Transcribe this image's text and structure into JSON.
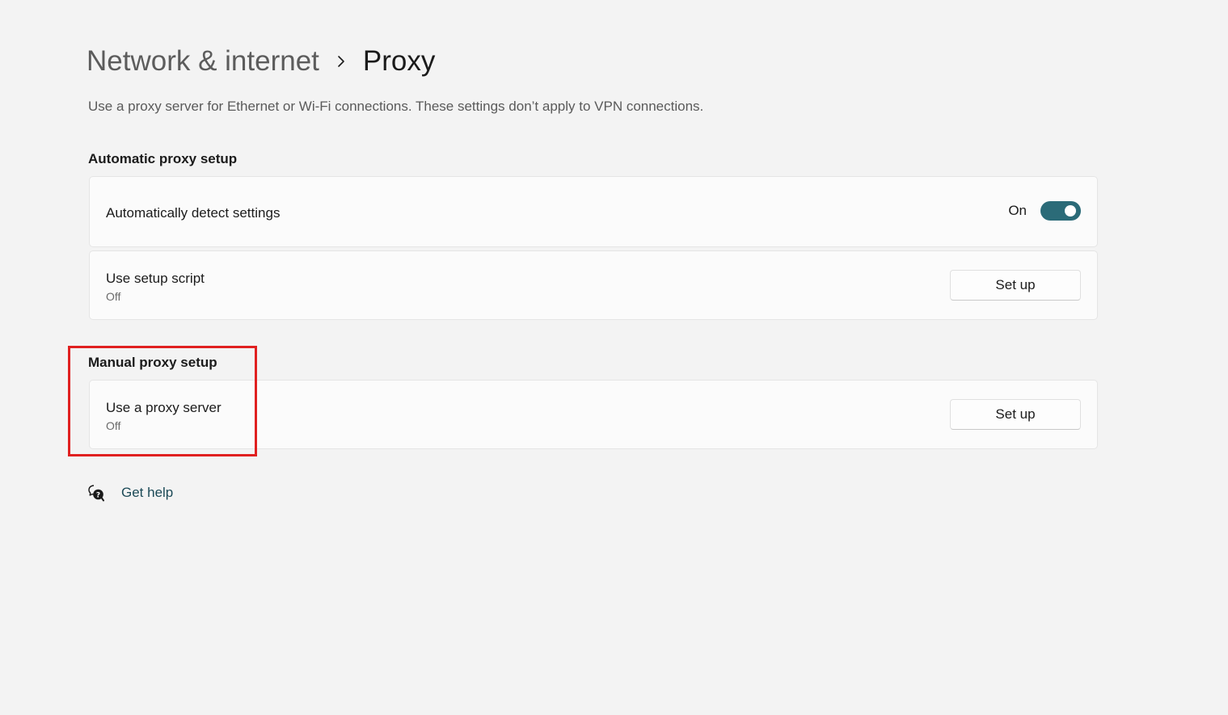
{
  "breadcrumb": {
    "parent": "Network & internet",
    "current": "Proxy",
    "separator_icon": "chevron-right-icon"
  },
  "description": "Use a proxy server for Ethernet or Wi-Fi connections. These settings don’t apply to VPN connections.",
  "automatic": {
    "heading": "Automatic proxy setup",
    "detect": {
      "label": "Automatically detect settings",
      "state_label": "On",
      "toggle_on": true
    },
    "script": {
      "label": "Use setup script",
      "status": "Off",
      "button_label": "Set up"
    }
  },
  "manual": {
    "heading": "Manual proxy setup",
    "proxy_server": {
      "label": "Use a proxy server",
      "status": "Off",
      "button_label": "Set up"
    }
  },
  "help": {
    "label": "Get help",
    "icon": "help-chat-icon"
  },
  "colors": {
    "background": "#f3f3f3",
    "card": "#fbfbfb",
    "accent": "#2b6b78",
    "link": "#1c4a57",
    "highlight": "#e02020"
  }
}
